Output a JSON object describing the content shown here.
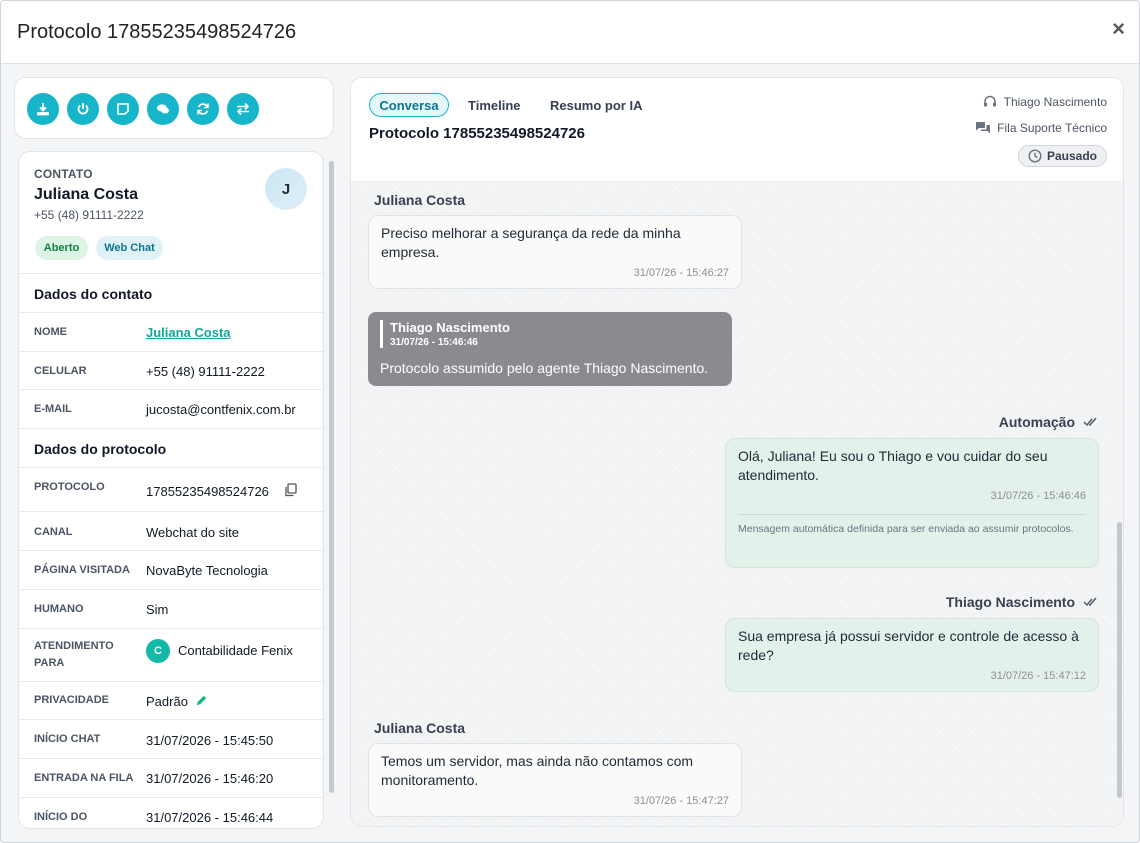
{
  "modal": {
    "title": "Protocolo 17855235498524726",
    "close_glyph": "×"
  },
  "toolbar": {
    "buttons": [
      {
        "name": "download-icon"
      },
      {
        "name": "power-icon"
      },
      {
        "name": "note-icon"
      },
      {
        "name": "chat-icon"
      },
      {
        "name": "refresh-icon"
      },
      {
        "name": "transfer-icon"
      }
    ],
    "accent": "#16b5c9"
  },
  "contact": {
    "label": "CONTATO",
    "name": "Juliana Costa",
    "phone": "+55 (48) 91111-2222",
    "avatar_initial": "J",
    "badges": {
      "status": "Aberto",
      "channel": "Web Chat"
    },
    "section_contact": "Dados do contato",
    "section_protocol": "Dados do protocolo",
    "fields": {
      "nome_label": "NOME",
      "nome_value": "Juliana Costa",
      "celular_label": "CELULAR",
      "celular_value": "+55 (48) 91111-2222",
      "email_label": "E-MAIL",
      "email_value": "jucosta@contfenix.com.br",
      "protocolo_label": "PROTOCOLO",
      "protocolo_value": "17855235498524726",
      "canal_label": "CANAL",
      "canal_value": "Webchat do site",
      "pagina_label": "PÁGINA VISITADA",
      "pagina_value": "NovaByte Tecnologia",
      "humano_label": "HUMANO",
      "humano_value": "Sim",
      "atendimento_label": "ATENDIMENTO PARA",
      "atendimento_initial": "C",
      "atendimento_value": "Contabilidade Fenix",
      "privacidade_label": "PRIVACIDADE",
      "privacidade_value": "Padrão",
      "inicio_chat_label": "INÍCIO CHAT",
      "inicio_chat_value": "31/07/2026 - 15:45:50",
      "entrada_fila_label": "ENTRADA NA FILA",
      "entrada_fila_value": "31/07/2026 - 15:46:20",
      "inicio_do_label": "INÍCIO DO",
      "inicio_do_value": "31/07/2026 - 15:46:44"
    }
  },
  "chat": {
    "tabs": [
      "Conversa",
      "Timeline",
      "Resumo por IA"
    ],
    "title": "Protocolo 17855235498524726",
    "agent": "Thiago Nascimento",
    "queue": "Fila Suporte Técnico",
    "status": "Pausado",
    "messages": [
      {
        "sender": "Juliana Costa",
        "text": "Preciso melhorar a segurança da rede da minha empresa.",
        "time": "31/07/26 - 15:46:27"
      },
      {
        "sender": "Thiago Nascimento",
        "time": "31/07/26 - 15:46:46",
        "text": "Protocolo assumido pelo agente Thiago Nascimento."
      },
      {
        "sender": "Automação",
        "text": "Olá, Juliana! Eu sou o Thiago e vou cuidar do seu atendimento.",
        "time": "31/07/26 - 15:46:46",
        "note": "Mensagem automática definida para ser enviada ao assumir protocolos."
      },
      {
        "sender": "Thiago Nascimento",
        "text": "Sua empresa já possui servidor e controle de acesso à rede?",
        "time": "31/07/26 - 15:47:12"
      },
      {
        "sender": "Juliana Costa",
        "text": "Temos um servidor, mas ainda não contamos com monitoramento.",
        "time": "31/07/26 - 15:47:27"
      }
    ]
  }
}
